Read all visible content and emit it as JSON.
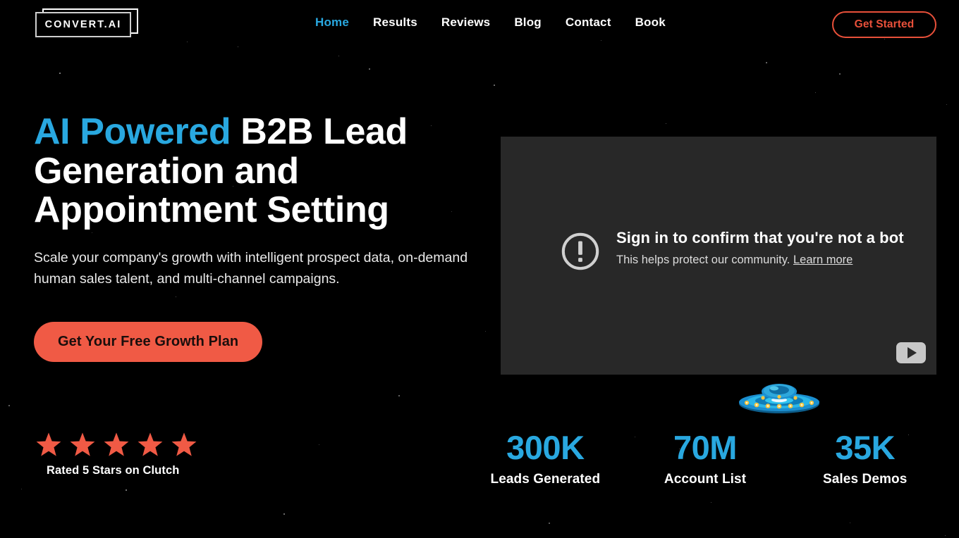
{
  "brand": {
    "logo_text": "CONVERT.AI"
  },
  "colors": {
    "background": "#000000",
    "accent_cyan": "#29a8e0",
    "accent_coral": "#f05a45",
    "outline_red": "#e8503a",
    "video_bg": "#282828"
  },
  "nav": {
    "items": [
      {
        "label": "Home",
        "active": true
      },
      {
        "label": "Results",
        "active": false
      },
      {
        "label": "Reviews",
        "active": false
      },
      {
        "label": "Blog",
        "active": false
      },
      {
        "label": "Contact",
        "active": false
      },
      {
        "label": "Book",
        "active": false
      }
    ],
    "cta_label": "Get Started"
  },
  "hero": {
    "headline_accent": "AI Powered",
    "headline_rest": " B2B Lead Generation and Appointment Setting",
    "subhead": "Scale your company's growth with intelligent prospect data, on-demand human sales talent, and multi-channel campaigns.",
    "cta_label": "Get Your Free Growth Plan"
  },
  "rating": {
    "stars": 5,
    "label": "Rated 5 Stars on Clutch",
    "star_color": "#f05a45"
  },
  "video": {
    "icons": {
      "warning": "exclamation-circle-icon",
      "play": "play-icon"
    },
    "botcheck_title": "Sign in to confirm that you're not a bot",
    "botcheck_sub": "This helps protect our community. ",
    "botcheck_link": "Learn more"
  },
  "decor": {
    "ufo": "ufo-icon"
  },
  "stats": [
    {
      "value": "300K",
      "label": "Leads Generated"
    },
    {
      "value": "70M",
      "label": "Account List"
    },
    {
      "value": "35K",
      "label": "Sales Demos"
    }
  ]
}
